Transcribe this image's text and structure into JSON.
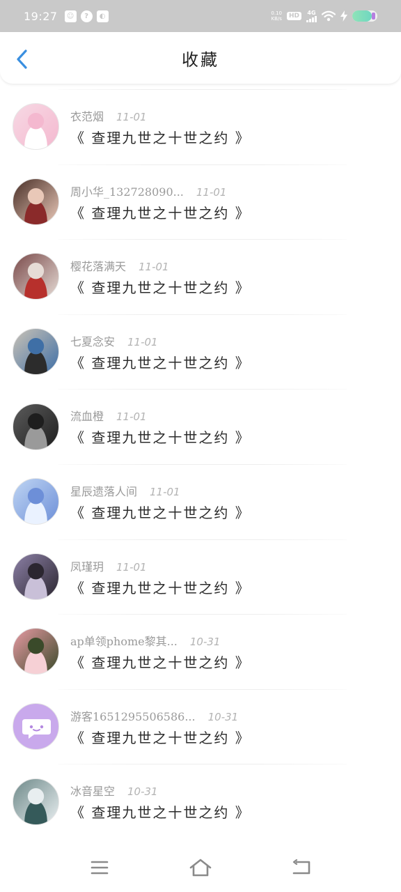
{
  "status_bar": {
    "time": "19:27",
    "net_speed_value": "0.10",
    "net_speed_unit": "KB/s",
    "hd_label": "HD",
    "network_label": "4G",
    "battery_level": 0.78
  },
  "header": {
    "title": "收藏"
  },
  "items": [
    {
      "user": "衣范烟",
      "date": "11-01",
      "title": "《 查理九世之十世之约 》",
      "avatar_colors": [
        "#f7d9e4",
        "#f4b8cf",
        "#fff"
      ]
    },
    {
      "user": "周小华_132728090...",
      "date": "11-01",
      "title": "《 查理九世之十世之约 》",
      "avatar_colors": [
        "#4a3028",
        "#e9c8b8",
        "#8a2a2a"
      ]
    },
    {
      "user": "樱花落满天",
      "date": "11-01",
      "title": "《 查理九世之十世之约 》",
      "avatar_colors": [
        "#7a4a4a",
        "#e6dcd6",
        "#b7302c"
      ]
    },
    {
      "user": "七夏念安",
      "date": "11-01",
      "title": "《 查理九世之十世之约 》",
      "avatar_colors": [
        "#c9c2b6",
        "#3f6fa6",
        "#2c2c2c"
      ]
    },
    {
      "user": "流血橙",
      "date": "11-01",
      "title": "《 查理九世之十世之约 》",
      "avatar_colors": [
        "#5b5b5b",
        "#1e1e1e",
        "#9a9a9a"
      ]
    },
    {
      "user": "星辰遗落人间",
      "date": "11-01",
      "title": "《 查理九世之十世之约 》",
      "avatar_colors": [
        "#bfd5f3",
        "#6d8fd8",
        "#eaf2ff"
      ]
    },
    {
      "user": "凤瑾玥",
      "date": "11-01",
      "title": "《 查理九世之十世之约 》",
      "avatar_colors": [
        "#8c80a6",
        "#2b2630",
        "#c9c0d8"
      ]
    },
    {
      "user": "ap单领phome黎其...",
      "date": "10-31",
      "title": "《 查理九世之十世之约 》",
      "avatar_colors": [
        "#e79aa3",
        "#3a4a2a",
        "#f6d0d5"
      ]
    },
    {
      "user": "游客1651295506586...",
      "date": "10-31",
      "title": "《 查理九世之十世之约 》",
      "avatar_colors": [
        "#c9a9ec",
        "#ffffff",
        "#b488e0"
      ]
    },
    {
      "user": "冰音星空",
      "date": "10-31",
      "title": "《 查理九世之十世之约 》",
      "avatar_colors": [
        "#6f8a8a",
        "#e8eef0",
        "#355a5a"
      ]
    }
  ]
}
